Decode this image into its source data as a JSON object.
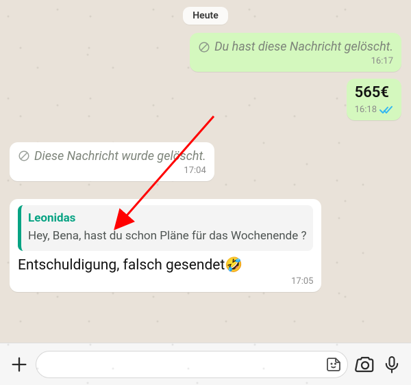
{
  "date_label": "Heute",
  "messages": {
    "out_deleted": {
      "text": "Du hast diese Nachricht gelöscht.",
      "time": "16:17"
    },
    "out_money": {
      "text": "565€",
      "time": "16:18"
    },
    "in_deleted": {
      "text": "Diese Nachricht wurde gelöscht.",
      "time": "17:04"
    },
    "in_reply": {
      "quote_sender": "Leonidas",
      "quote_text": "Hey, Bena, hast du schon Pläne für das Wochenende ?",
      "text": "Entschuldigung, falsch gesendet🤣",
      "time": "17:05"
    }
  },
  "composer": {
    "placeholder": ""
  },
  "colors": {
    "accent_green": "#07a383",
    "out_bubble": "#d4f8be",
    "ticks_blue": "#34b7f1",
    "arrow_red": "#ff0000"
  }
}
